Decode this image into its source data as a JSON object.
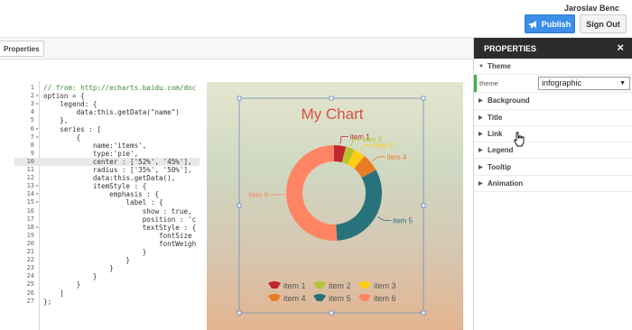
{
  "header": {
    "user_name": "Jaroslav Benc",
    "publish_label": "Publish",
    "signout_label": "Sign Out"
  },
  "toolbar": {
    "properties_tab": "Properties"
  },
  "editor": {
    "lines": [
      {
        "n": "1",
        "fold": "",
        "text": "// from: http://echarts.baidu.com/doc",
        "cls": "c-comment"
      },
      {
        "n": "2",
        "fold": "▾",
        "text": "option = {",
        "cls": ""
      },
      {
        "n": "3",
        "fold": "▾",
        "text": "    legend: {",
        "cls": ""
      },
      {
        "n": "4",
        "fold": "",
        "text": "        data:this.getData(\"name\")",
        "cls": ""
      },
      {
        "n": "5",
        "fold": "",
        "text": "    },",
        "cls": ""
      },
      {
        "n": "6",
        "fold": "▾",
        "text": "    series : [",
        "cls": ""
      },
      {
        "n": "7",
        "fold": "▾",
        "text": "        {",
        "cls": ""
      },
      {
        "n": "8",
        "fold": "",
        "text": "            name:'items',",
        "cls": ""
      },
      {
        "n": "9",
        "fold": "",
        "text": "            type:'pie',",
        "cls": ""
      },
      {
        "n": "10",
        "fold": "",
        "text": "            center : ['52%', '45%'],",
        "cls": "",
        "hl": true
      },
      {
        "n": "11",
        "fold": "",
        "text": "            radius : ['35%', '50%'],",
        "cls": ""
      },
      {
        "n": "12",
        "fold": "",
        "text": "            data:this.getData(),",
        "cls": ""
      },
      {
        "n": "13",
        "fold": "▾",
        "text": "            itemStyle : {",
        "cls": ""
      },
      {
        "n": "14",
        "fold": "▾",
        "text": "                emphasis : {",
        "cls": ""
      },
      {
        "n": "15",
        "fold": "▾",
        "text": "                    label : {",
        "cls": ""
      },
      {
        "n": "16",
        "fold": "",
        "text": "                        show : true,",
        "cls": ""
      },
      {
        "n": "17",
        "fold": "",
        "text": "                        position : 'c",
        "cls": ""
      },
      {
        "n": "18",
        "fold": "▾",
        "text": "                        textStyle : {",
        "cls": ""
      },
      {
        "n": "19",
        "fold": "",
        "text": "                            fontSize",
        "cls": ""
      },
      {
        "n": "20",
        "fold": "",
        "text": "                            fontWeigh",
        "cls": ""
      },
      {
        "n": "21",
        "fold": "",
        "text": "                        }",
        "cls": ""
      },
      {
        "n": "22",
        "fold": "",
        "text": "                    }",
        "cls": ""
      },
      {
        "n": "23",
        "fold": "",
        "text": "                }",
        "cls": ""
      },
      {
        "n": "24",
        "fold": "",
        "text": "            }",
        "cls": ""
      },
      {
        "n": "25",
        "fold": "",
        "text": "        }",
        "cls": ""
      },
      {
        "n": "26",
        "fold": "",
        "text": "    ]",
        "cls": ""
      },
      {
        "n": "27",
        "fold": "",
        "text": "};",
        "cls": ""
      }
    ]
  },
  "chart_data": {
    "type": "pie",
    "title": "My Chart",
    "donut": true,
    "labels": [
      "item 1",
      "item 2",
      "item 3",
      "item 4",
      "item 5",
      "item 6"
    ],
    "values": [
      4,
      3,
      4,
      6,
      32,
      51
    ],
    "colors": [
      "#c2262c",
      "#b5c334",
      "#fcce10",
      "#e87c25",
      "#27727b",
      "#fe8463"
    ],
    "legend_position": "bottom",
    "title_color": "#dd4f43"
  },
  "properties": {
    "title": "PROPERTIES",
    "sections": [
      {
        "label": "Theme",
        "expanded": true
      },
      {
        "label": "Background",
        "expanded": false
      },
      {
        "label": "Title",
        "expanded": false
      },
      {
        "label": "Link",
        "expanded": false
      },
      {
        "label": "Legend",
        "expanded": false
      },
      {
        "label": "Tooltip",
        "expanded": false
      },
      {
        "label": "Animation",
        "expanded": false
      }
    ],
    "theme_label": "theme",
    "theme_value": "infographic"
  },
  "colors": {
    "publish": "#3d8ee8",
    "panel_header": "#2c2c2c",
    "theme_accent": "#3cb04a"
  }
}
